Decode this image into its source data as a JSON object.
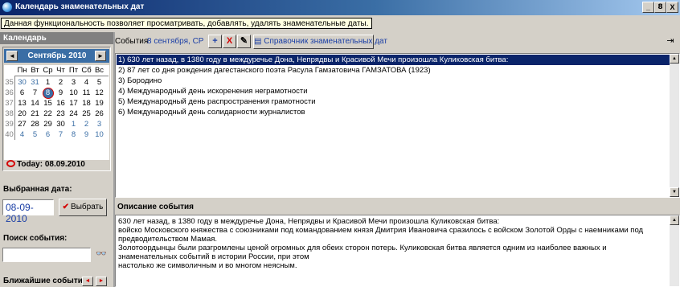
{
  "window": {
    "title": "Календарь знаменательных дат",
    "buttons": [
      "_",
      "8",
      "X"
    ]
  },
  "info": {
    "tip": "Данная функциональность позволяет просматривать, добавлять, удалять знаменательные даты."
  },
  "calendar": {
    "header": "Календарь",
    "month_label": "Сентябрь 2010",
    "prev": "◄",
    "next": "►",
    "dow": [
      "Пн",
      "Вт",
      "Ср",
      "Чт",
      "Пт",
      "Сб",
      "Вс"
    ],
    "weeks": [
      {
        "wk": "35",
        "days": [
          "30",
          "31",
          "1",
          "2",
          "3",
          "4",
          "5"
        ]
      },
      {
        "wk": "36",
        "days": [
          "6",
          "7",
          "8",
          "9",
          "10",
          "11",
          "12"
        ]
      },
      {
        "wk": "37",
        "days": [
          "13",
          "14",
          "15",
          "16",
          "17",
          "18",
          "19"
        ]
      },
      {
        "wk": "38",
        "days": [
          "20",
          "21",
          "22",
          "23",
          "24",
          "25",
          "26"
        ]
      },
      {
        "wk": "39",
        "days": [
          "27",
          "28",
          "29",
          "30",
          "1",
          "2",
          "3"
        ]
      },
      {
        "wk": "40",
        "days": [
          "4",
          "5",
          "6",
          "7",
          "8",
          "9",
          "10"
        ]
      }
    ],
    "today_label": "Today: 08.09.2010"
  },
  "selected": {
    "header": "Выбранная дата:",
    "date": "08-09-2010",
    "button": "Выбрать"
  },
  "search": {
    "header": "Поиск события:",
    "value": ""
  },
  "nearest": {
    "header": "Ближайшие события",
    "prev": "◄",
    "next": "►"
  },
  "events": {
    "label": "События",
    "date": "8 сентября, СР",
    "add_icon": "+",
    "delete_icon": "X",
    "edit_icon": "✎",
    "reference_button": "Справочник знаменательных дат",
    "items": [
      "1) 630 лет назад, в 1380 году в междуречье Дона, Непрядвы и Красивой Мечи произошла Куликовская битва:",
      "2) 87 лет со дня рождения дагестанского поэта Расула Гамзатовича ГАМЗАТОВА (1923)",
      "3) Бородино",
      "4) Международный день искоренения неграмотности",
      "5) Международный день распространения грамотности",
      "6) Международный день солидарности журналистов"
    ]
  },
  "description": {
    "header": "Описание события",
    "text": "630 лет назад, в 1380 году в междуречье Дона, Непрядвы и Красивой Мечи произошла Куликовская битва:\nвойско Московского княжества с союзниками под командованием князя Дмитрия Ивановича сразилось с войском Золотой Орды с наемниками под предводительством Мамая.\nЗолотоордынцы были разгромлены ценой огромных для обеих сторон потерь. Куликовская битва является одним из наиболее важных и знаменательных событий в истории России, при этом\nнастолько же символичным и во многом неясным."
  }
}
